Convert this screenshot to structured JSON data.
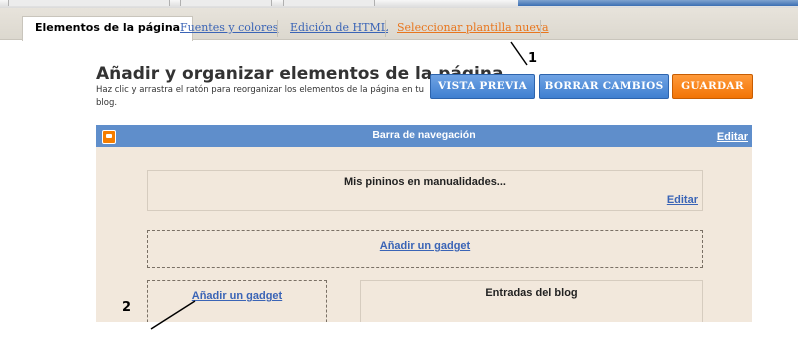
{
  "tabs": {
    "active": "Elementos de la página",
    "fonts": "Fuentes y colores",
    "html": "Edición de HTML",
    "template": "Seleccionar plantilla nueva"
  },
  "header": {
    "title": "Añadir y organizar elementos de la página",
    "subtitle": "Haz clic y arrastra el ratón para reorganizar los elementos de la página en tu blog."
  },
  "buttons": {
    "preview": "VISTA PREVIA",
    "clear": "BORRAR CAMBIOS",
    "save": "GUARDAR"
  },
  "annotations": {
    "one": "1",
    "two": "2"
  },
  "layout": {
    "navbar_title": "Barra de navegación",
    "navbar_edit": "Editar",
    "header_widget_title": "Mis pininos en manualidades...",
    "header_widget_edit": "Editar",
    "add_gadget_main": "Añadir un gadget",
    "add_gadget_sidebar": "Añadir un gadget",
    "posts_title": "Entradas del blog"
  },
  "colors": {
    "tab_link": "#3a64b6",
    "tab_template": "#e8761e",
    "button_blue": "#4f8bd6",
    "button_orange": "#f27405",
    "navbar": "#5f8ecb",
    "editor_bg": "#f2e8dc"
  },
  "icons": {
    "navbar": "blogger-icon"
  }
}
